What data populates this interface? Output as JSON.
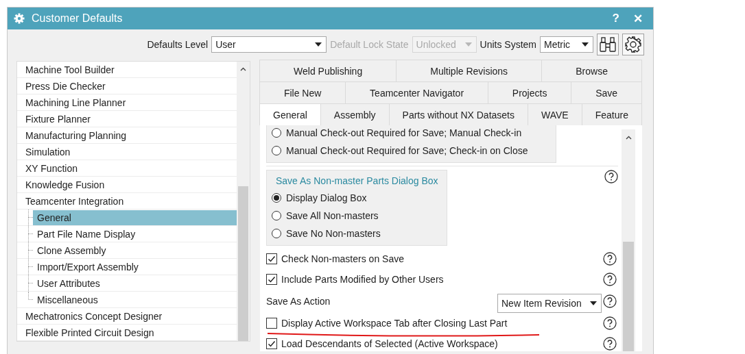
{
  "window": {
    "title": "Customer Defaults",
    "help_button": "?",
    "close_button": "✕"
  },
  "toolbar": {
    "defaults_level": {
      "label": "Defaults Level",
      "value": "User"
    },
    "lock_state": {
      "label": "Default Lock State",
      "value": "Unlocked",
      "disabled": true
    },
    "units_system": {
      "label": "Units System",
      "value": "Metric"
    }
  },
  "tree": {
    "items": [
      {
        "label": "Machine Tool Builder",
        "selected": false
      },
      {
        "label": "Press Die Checker",
        "selected": false
      },
      {
        "label": "Machining Line Planner",
        "selected": false
      },
      {
        "label": "Fixture Planner",
        "selected": false
      },
      {
        "label": "Manufacturing Planning",
        "selected": false
      },
      {
        "label": "Simulation",
        "selected": false
      },
      {
        "label": "XY Function",
        "selected": false
      },
      {
        "label": "Knowledge Fusion",
        "selected": false
      },
      {
        "label": "Teamcenter Integration",
        "selected": false,
        "children": [
          {
            "label": "General",
            "selected": true
          },
          {
            "label": "Part File Name Display",
            "selected": false
          },
          {
            "label": "Clone Assembly",
            "selected": false
          },
          {
            "label": "Import/Export Assembly",
            "selected": false
          },
          {
            "label": "User Attributes",
            "selected": false
          },
          {
            "label": "Miscellaneous",
            "selected": false
          }
        ]
      },
      {
        "label": "Mechatronics Concept Designer",
        "selected": false
      },
      {
        "label": "Flexible Printed Circuit Design",
        "selected": false
      }
    ]
  },
  "tabs": {
    "rows": [
      {
        "tabs": [
          {
            "label": "Weld Publishing",
            "selected": false
          },
          {
            "label": "Multiple Revisions",
            "selected": false
          },
          {
            "label": "Browse",
            "selected": false
          }
        ]
      },
      {
        "tabs": [
          {
            "label": "File New",
            "selected": false
          },
          {
            "label": "Teamcenter Navigator",
            "selected": false
          },
          {
            "label": "Projects",
            "selected": false
          },
          {
            "label": "Save",
            "selected": false
          }
        ]
      },
      {
        "tabs": [
          {
            "label": "General",
            "selected": true
          },
          {
            "label": "Assembly",
            "selected": false
          },
          {
            "label": "Parts without NX Datasets",
            "selected": false
          },
          {
            "label": "WAVE",
            "selected": false
          },
          {
            "label": "Feature",
            "selected": false
          }
        ]
      }
    ]
  },
  "content": {
    "items": [
      {
        "kind": "radio_group",
        "help": false,
        "options": [
          {
            "label": "Manual Check-out Required for Save; Manual Check-in",
            "selected": false
          },
          {
            "label": "Manual Check-out Required for Save; Check-in on Close",
            "selected": false
          }
        ]
      },
      {
        "kind": "radio_group",
        "title": "Save As Non-master Parts Dialog Box",
        "help": true,
        "options": [
          {
            "label": "Display Dialog Box",
            "selected": true
          },
          {
            "label": "Save All Non-masters",
            "selected": false
          },
          {
            "label": "Save No Non-masters",
            "selected": false
          }
        ]
      },
      {
        "kind": "checkbox",
        "label": "Check Non-masters on Save",
        "checked": true,
        "help": true
      },
      {
        "kind": "checkbox",
        "label": "Include Parts Modified by Other Users",
        "checked": true,
        "help": true
      },
      {
        "kind": "dropdown",
        "label": "Save As Action",
        "value": "New Item Revision",
        "help": true
      },
      {
        "kind": "checkbox",
        "label": "Display Active Workspace Tab after Closing Last Part",
        "checked": false,
        "help": true,
        "underlined": true
      },
      {
        "kind": "checkbox",
        "label": "Load Descendants of Selected (Active Workspace)",
        "checked": true,
        "help": true
      }
    ]
  }
}
